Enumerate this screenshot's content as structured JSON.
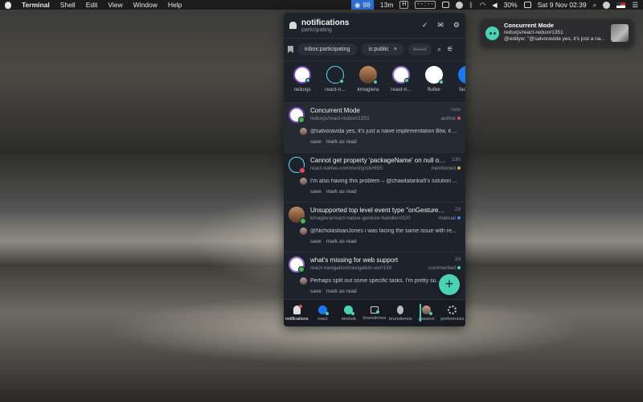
{
  "menubar": {
    "app": "Terminal",
    "menus": [
      "Shell",
      "Edit",
      "View",
      "Window",
      "Help"
    ],
    "devhub_count": "98",
    "timer": "13m",
    "h_badge": "H",
    "dash": "- - : - -",
    "battery": "30%",
    "datetime": "Sat 9 Nov  02:39"
  },
  "toast": {
    "title": "Concurrent Mode",
    "line1": "reduxjs/react-redux#1351",
    "line2": "@eddyw: \"@salvoravida yes, it's just a na..."
  },
  "header": {
    "title": "notifications",
    "subtitle": "participating",
    "actions": [
      "✓",
      "✉",
      "⚙"
    ]
  },
  "filters": {
    "chips": [
      "inbox:participating",
      "is:public"
    ],
    "faded": "is:unr",
    "chip_close": "×"
  },
  "avatars": [
    {
      "name": "reduxjs",
      "kind": "redux"
    },
    {
      "name": "react-n...",
      "kind": "react"
    },
    {
      "name": "kmagiera",
      "kind": "person"
    },
    {
      "name": "react-n...",
      "kind": "rnav"
    },
    {
      "name": "flutter",
      "kind": "flutter"
    },
    {
      "name": "facebo",
      "kind": "fb"
    }
  ],
  "items": [
    {
      "title": "Concurrent Mode",
      "time": "now",
      "repo": "reduxjs/react-redux#1351",
      "reason": "author",
      "reason_color": "#e24c4c",
      "comment": "@salvoravida yes, it's just a naive implementation Btw, it ...",
      "save": "save",
      "mark": "mark as read",
      "icon": "redux",
      "status": "green"
    },
    {
      "title": "Cannot get property 'packageName' on null obj...",
      "time": "13h",
      "repo": "react-native-community/cli#655",
      "reason": "mentioned",
      "reason_color": "#e8a33a",
      "comment": "I'm also having this problem – @chawlatarika5's solution ...",
      "save": "save",
      "mark": "mark as read",
      "icon": "react",
      "status": "red"
    },
    {
      "title": "Unsupported top level event type \"onGestureHa...",
      "time": "2d",
      "repo": "kmagiera/react-native-gesture-handler#320",
      "reason": "manual",
      "reason_color": "#3b82f6",
      "comment": "@NicholasloanJones i was facing the same issue with re...",
      "save": "save",
      "mark": "mark as read",
      "icon": "person",
      "status": "green"
    },
    {
      "title": "what's missing for web support",
      "time": "2d",
      "repo": "react-navigation/navigation-ex#130",
      "reason": "commented",
      "reason_color": "#49d3b4",
      "comment": "Perhaps split out some specific tasks. I'm pretty su...",
      "save": "save",
      "mark": "mark as read",
      "icon": "rnav",
      "status": "green"
    }
  ],
  "fab": "+",
  "nav": [
    {
      "label": "notifications",
      "icon": "bell"
    },
    {
      "label": "react",
      "icon": "fbi"
    },
    {
      "label": "devhub",
      "icon": "dh"
    },
    {
      "label": "brunolemos",
      "icon": "home"
    },
    {
      "label": "brunolemos",
      "icon": "usr"
    },
    {
      "label": "gaearon",
      "icon": "gaa"
    },
    {
      "label": "preferences",
      "icon": "gear"
    }
  ]
}
